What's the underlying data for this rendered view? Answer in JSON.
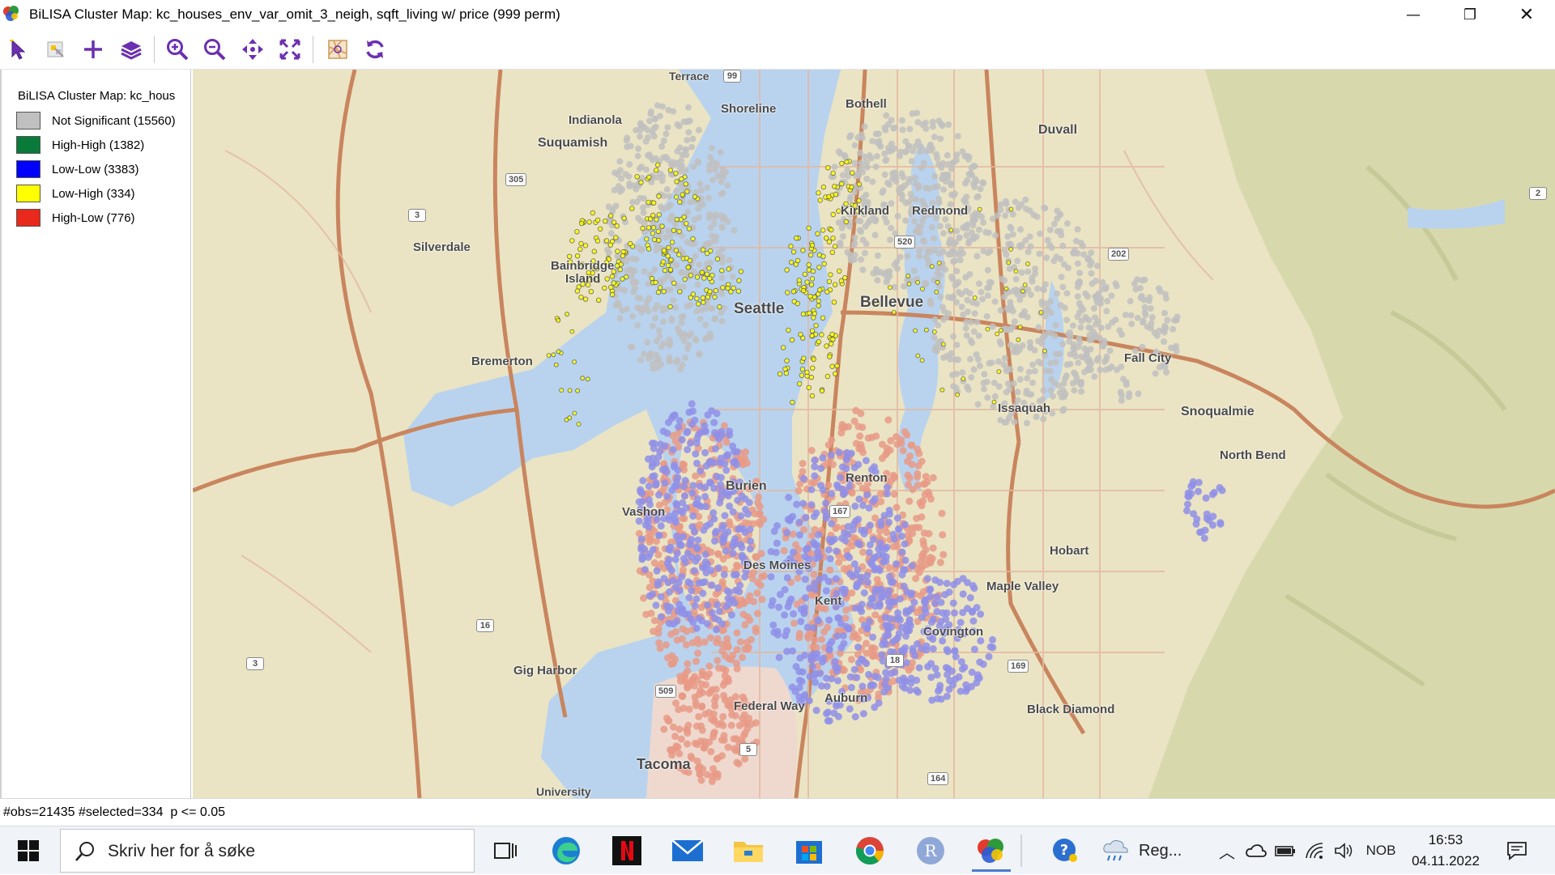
{
  "window": {
    "title": "BiLISA Cluster Map: kc_houses_env_var_omit_3_neigh, sqft_living w/ price (999 perm)",
    "min_glyph": "—",
    "max_glyph": "❐",
    "close_glyph": "✕"
  },
  "toolbar": {
    "tools": [
      "select-tool",
      "select-all-tool",
      "add-tool",
      "layers-tool",
      "zoom-in-tool",
      "zoom-out-tool",
      "pan-tool",
      "full-extent-tool",
      "basemap-tool",
      "refresh-tool"
    ]
  },
  "legend": {
    "title": "BiLISA Cluster Map: kc_hous",
    "items": [
      {
        "label": "Not Significant (15560)",
        "color": "#c0c0c0"
      },
      {
        "label": "High-High (1382)",
        "color": "#0a7a3a"
      },
      {
        "label": "Low-Low (3383)",
        "color": "#0000ff"
      },
      {
        "label": "Low-High (334)",
        "color": "#ffff00"
      },
      {
        "label": "High-Low (776)",
        "color": "#e8291b"
      }
    ]
  },
  "map": {
    "places": [
      "Terrace",
      "Shoreline",
      "Bothell",
      "Duvall",
      "Indianola",
      "Suquamish",
      "Kirkland",
      "Redmond",
      "Silverdale",
      "Bainbridge",
      "Island",
      "Seattle",
      "Bellevue",
      "Bremerton",
      "Fall City",
      "Issaquah",
      "Snoqualmie",
      "North Bend",
      "Burien",
      "Renton",
      "Vashon",
      "Hobart",
      "Des Moines",
      "Kent",
      "Maple Valley",
      "Covington",
      "Gig Harbor",
      "Auburn",
      "Federal Way",
      "Black Diamond",
      "Tacoma",
      "University"
    ],
    "shields": [
      "99",
      "305",
      "3",
      "520",
      "202",
      "167",
      "16",
      "3",
      "509",
      "18",
      "169",
      "164",
      "5",
      "2"
    ],
    "colors": {
      "land": "#eae4c4",
      "forest": "#d9dbb0",
      "water": "#b9d3ee",
      "urban": "#efd9cf",
      "road_major": "#c9855e",
      "road_minor": "#e3b8a0",
      "not_significant": "#c0c0c0",
      "low_low": "#8f8fe8",
      "low_high": "#ffff00",
      "high_low": "#e89a86"
    }
  },
  "status": {
    "text": "#obs=21435 #selected=334  p <= 0.05"
  },
  "taskbar": {
    "search_placeholder": "Skriv her for å søke",
    "weather_label": "Reg...",
    "language": "NOB",
    "time": "16:53",
    "date": "04.11.2022",
    "apps": [
      "task-view",
      "edge",
      "netflix",
      "mail",
      "file-explorer",
      "store",
      "chrome",
      "r-app",
      "geoda"
    ]
  }
}
